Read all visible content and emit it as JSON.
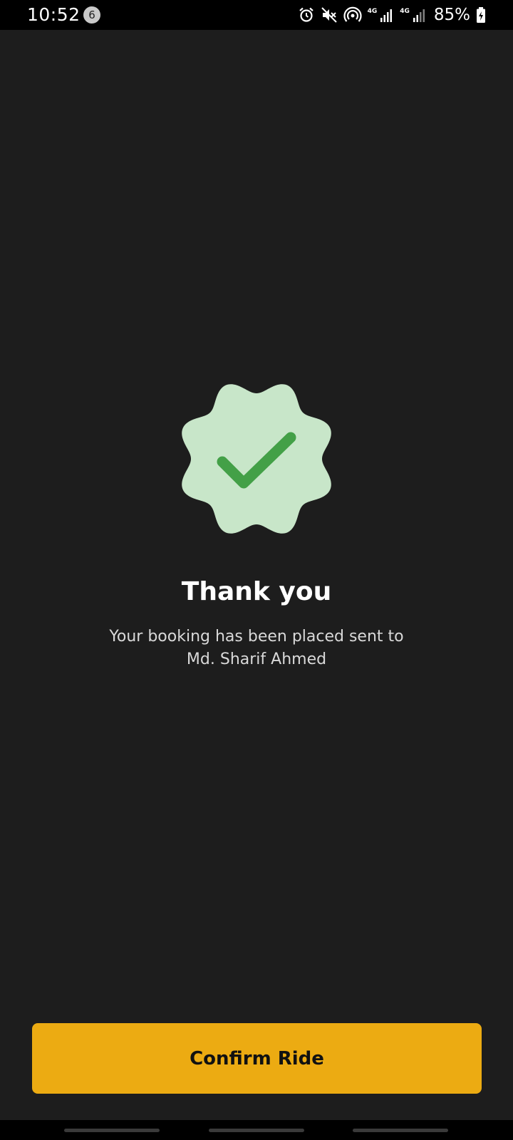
{
  "status_bar": {
    "time": "10:52",
    "notification_count": "6",
    "network_1": "4G",
    "network_2": "4G",
    "battery": "85%",
    "icons": [
      "alarm-icon",
      "mute-icon",
      "hotspot-icon",
      "signal-icon",
      "signal-icon",
      "battery-charging-icon"
    ]
  },
  "main": {
    "title": "Thank you",
    "message_line_1": "Your booking has been placed sent to",
    "message_line_2": "Md. Sharif Ahmed"
  },
  "confirm_button": {
    "label": "Confirm Ride"
  },
  "colors": {
    "background": "#1d1d1d",
    "badge_fill": "#c8e6c9",
    "check_color": "#43a047",
    "accent": "#ecab12"
  }
}
